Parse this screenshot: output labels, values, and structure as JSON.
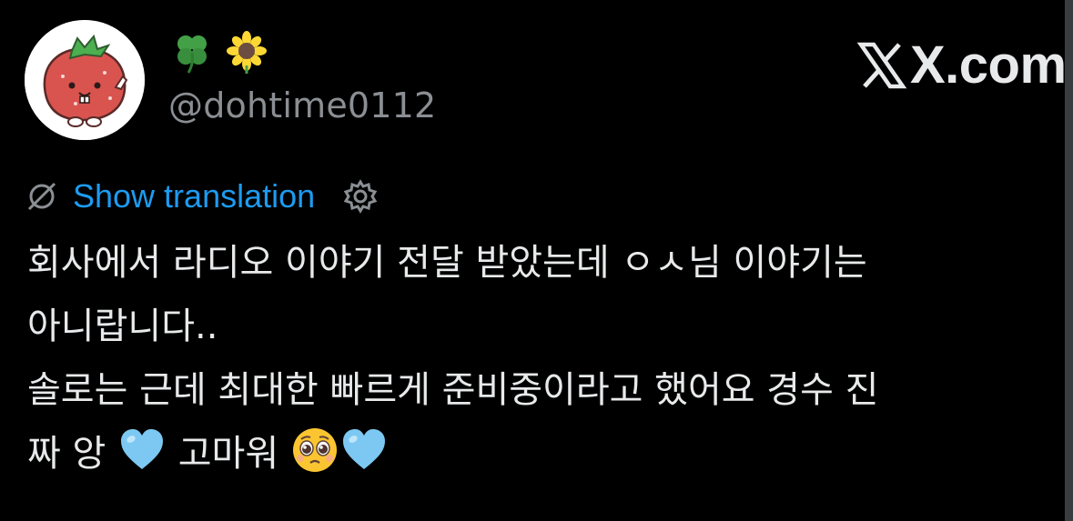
{
  "header": {
    "display_name_emojis": [
      "four-leaf-clover",
      "sunflower"
    ],
    "handle": "@dohtime0112",
    "brand": "X.com"
  },
  "translation": {
    "link_label": "Show translation"
  },
  "tweet": {
    "line1": "회사에서 라디오 이야기 전달 받았는데 ㅇㅅ님 이야기는",
    "line2": "아니랍니다..",
    "line3": "솔로는 근데 최대한 빠르게 준비중이라고 했어요 경수 진",
    "line4_text_a": "짜 앙 ",
    "line4_text_b": " 고마워 ",
    "line4_emojis": [
      "light-blue-heart",
      "pleading-face",
      "light-blue-heart"
    ]
  },
  "colors": {
    "background": "#000000",
    "text": "#e7e9ea",
    "handle": "#8b8f93",
    "link": "#1d9bf0",
    "heart": "#7cc8f2"
  }
}
